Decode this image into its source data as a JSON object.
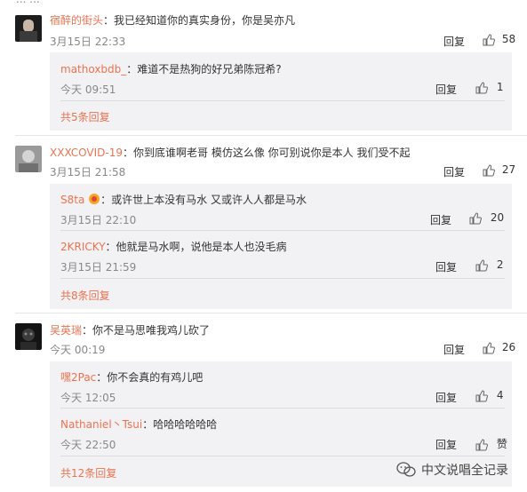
{
  "top_fragment": "... ...",
  "comments": [
    {
      "user": "宿醉的街头",
      "text": "：我已经知道你的真实身份，你是吴亦凡",
      "time": "3月15日 22:33",
      "reply": "回复",
      "likes": "58",
      "replies": [
        {
          "user": "mathoxbdb_",
          "text": "：难道不是热狗的好兄弟陈冠希?",
          "time": "今天 09:51",
          "reply": "回复",
          "likes": "1"
        }
      ],
      "more": "共5条回复"
    },
    {
      "user": "XXXCOVID-19",
      "text": "：你到底谁啊老哥 模仿这么像 你可别说你是本人 我们受不起",
      "time": "3月15日 21:58",
      "reply": "回复",
      "likes": "27",
      "replies": [
        {
          "user": "S8ta",
          "text": "：或许世上本没有马水 又或许人人都是马水",
          "time": "3月15日 22:10",
          "reply": "回复",
          "likes": "20"
        },
        {
          "user": "2KRICKY",
          "text": "：他就是马水啊，说他是本人也没毛病",
          "time": "3月15日 21:59",
          "reply": "回复",
          "likes": "2"
        }
      ],
      "more": "共8条回复"
    },
    {
      "user": "吴英瑞",
      "text": "：你不是马思唯我鸡儿砍了",
      "time": "今天 00:19",
      "reply": "回复",
      "likes": "26",
      "replies": [
        {
          "user": "嘿2Pac",
          "text": "：你不会真的有鸡儿吧",
          "time": "今天 12:05",
          "reply": "回复",
          "likes": "4"
        },
        {
          "user": "Nathaniel丶Tsui",
          "text": "：哈哈哈哈哈哈",
          "time": "今天 22:50",
          "reply": "回复",
          "likes": "赞"
        }
      ],
      "more": "共12条回复"
    }
  ],
  "watermark": "中文说唱全记录",
  "colors": {
    "accent": "#eb7350",
    "reply_bg": "#f2f2f5",
    "muted": "#888888"
  }
}
